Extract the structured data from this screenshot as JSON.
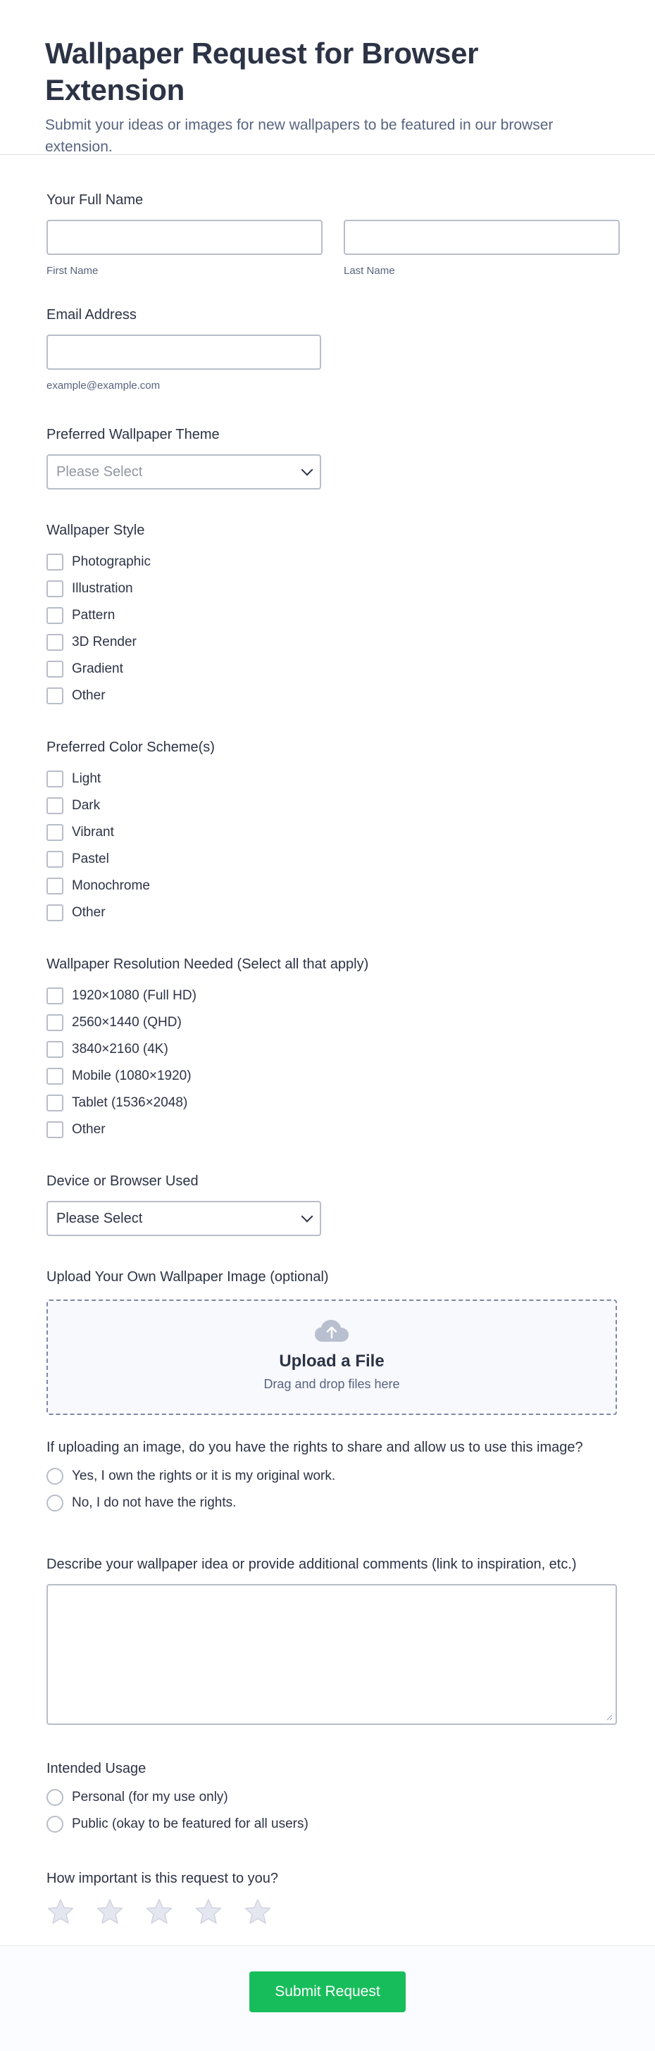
{
  "form": {
    "title": "Wallpaper Request for Browser Extension",
    "subtitle": "Submit your ideas or images for new wallpapers to be featured in our browser extension."
  },
  "full_name": {
    "label": "Your Full Name",
    "first_sub": "First Name",
    "last_sub": "Last Name"
  },
  "email": {
    "label": "Email Address",
    "sub": "example@example.com"
  },
  "theme": {
    "label": "Preferred Wallpaper Theme",
    "selected": "Please Select"
  },
  "style": {
    "label": "Wallpaper Style",
    "options": [
      "Photographic",
      "Illustration",
      "Pattern",
      "3D Render",
      "Gradient",
      "Other"
    ]
  },
  "color_scheme": {
    "label": "Preferred Color Scheme(s)",
    "options": [
      "Light",
      "Dark",
      "Vibrant",
      "Pastel",
      "Monochrome",
      "Other"
    ]
  },
  "resolution": {
    "label": "Wallpaper Resolution Needed (Select all that apply)",
    "options": [
      "1920×1080 (Full HD)",
      "2560×1440 (QHD)",
      "3840×2160 (4K)",
      "Mobile (1080×1920)",
      "Tablet (1536×2048)",
      "Other"
    ]
  },
  "device": {
    "label": "Device or Browser Used",
    "selected": "Please Select"
  },
  "upload": {
    "label": "Upload Your Own Wallpaper Image (optional)",
    "title": "Upload a File",
    "sub": "Drag and drop files here",
    "icon": "cloud-upload-icon"
  },
  "rights": {
    "label": "If uploading an image, do you have the rights to share and allow us to use this image?",
    "options": [
      "Yes, I own the rights or it is my original work.",
      "No, I do not have the rights."
    ]
  },
  "description": {
    "label": "Describe your wallpaper idea or provide additional comments (link to inspiration, etc.)"
  },
  "usage": {
    "label": "Intended Usage",
    "options": [
      "Personal (for my use only)",
      "Public (okay to be featured for all users)"
    ]
  },
  "importance": {
    "label": "How important is this request to you?",
    "rating": 0,
    "max": 5
  },
  "submit": {
    "label": "Submit Request"
  },
  "colors": {
    "accent": "#18bd5b",
    "text": "#2c3345",
    "border": "#b8bdc9"
  }
}
